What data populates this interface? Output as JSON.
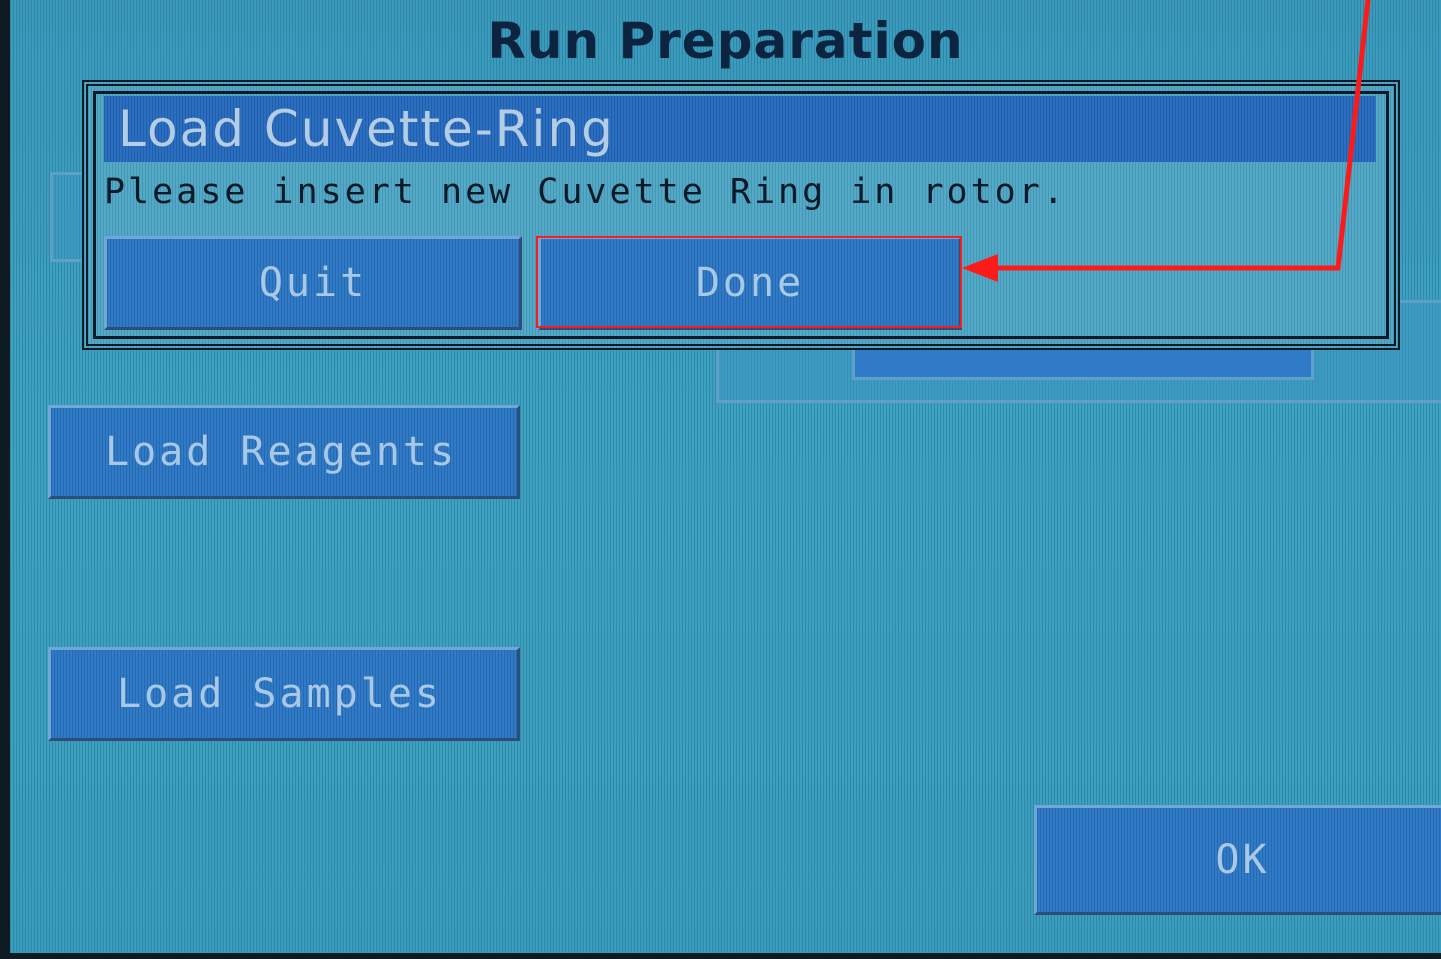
{
  "screen_title": "Run Preparation",
  "dialog": {
    "title": "Load Cuvette-Ring",
    "message": "Please insert new Cuvette Ring in rotor.",
    "quit_label": "Quit",
    "done_label": "Done"
  },
  "buttons": {
    "load_reagents": "Load Reagents",
    "load_samples": "Load Samples",
    "ok": "OK"
  },
  "colors": {
    "screen_background": "#3ea3c2",
    "button_fill": "#2f7bc7",
    "annotation": "#ff1a1a"
  }
}
